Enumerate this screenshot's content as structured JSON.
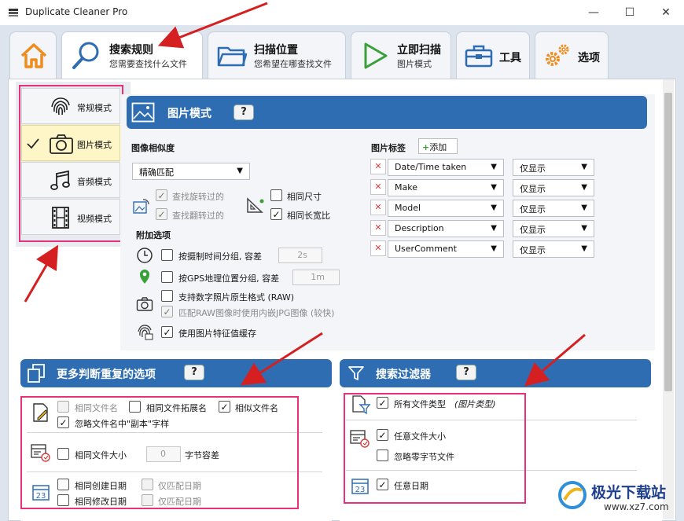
{
  "window": {
    "title": "Duplicate Cleaner Pro",
    "controls": [
      "—",
      "☐",
      "✕"
    ]
  },
  "tabs": [
    {
      "id": "home",
      "label": ""
    },
    {
      "id": "search-rules",
      "label": "搜索规则",
      "sub": "您需要查找什么文件"
    },
    {
      "id": "scan-location",
      "label": "扫描位置",
      "sub": "您希望在哪查找文件"
    },
    {
      "id": "scan-now",
      "label": "立即扫描",
      "sub": "图片模式"
    },
    {
      "id": "tools",
      "label": "工具"
    },
    {
      "id": "options",
      "label": "选项"
    }
  ],
  "modes": [
    {
      "label": "常规模式",
      "icon": "fingerprint-icon",
      "selected": false
    },
    {
      "label": "图片模式",
      "icon": "camera-icon",
      "selected": true
    },
    {
      "label": "音频模式",
      "icon": "music-note-icon",
      "selected": false
    },
    {
      "label": "视频模式",
      "icon": "film-icon",
      "selected": false
    }
  ],
  "image_mode": {
    "title": "图片模式",
    "help": "?",
    "similarity": {
      "label": "图像相似度",
      "value": "精确匹配"
    },
    "rotate": {
      "label": "查找旋转过的",
      "checked": true
    },
    "flip": {
      "label": "查找翻转过的",
      "checked": true
    },
    "same_size": {
      "label": "相同尺寸",
      "checked": false
    },
    "same_ratio": {
      "label": "相同长宽比",
      "checked": true
    },
    "extra": {
      "label": "附加选项",
      "time_group": {
        "label": "按摄制时间分组, 容差",
        "checked": false,
        "value": "2s"
      },
      "gps_group": {
        "label": "按GPS地理位置分组, 容差",
        "checked": false,
        "value": "1m"
      },
      "raw": {
        "label": "支持数字照片原生格式 (RAW)",
        "checked": false
      },
      "raw_jpg": {
        "label": "匹配RAW图像时使用内嵌JPG图像 (较快)",
        "checked": true
      },
      "cache": {
        "label": "使用图片特征值缓存",
        "checked": true
      }
    },
    "tags": {
      "label": "图片标签",
      "add_label": "添加",
      "rows": [
        {
          "tag": "Date/Time taken",
          "mode": "仅显示"
        },
        {
          "tag": "Make",
          "mode": "仅显示"
        },
        {
          "tag": "Model",
          "mode": "仅显示"
        },
        {
          "tag": "Description",
          "mode": "仅显示"
        },
        {
          "tag": "UserComment",
          "mode": "仅显示"
        }
      ]
    }
  },
  "more_options": {
    "title": "更多判断重复的选项",
    "help": "?",
    "same_name": {
      "label": "相同文件名",
      "checked": false
    },
    "same_ext": {
      "label": "相同文件拓展名",
      "checked": false
    },
    "similar_name": {
      "label": "相似文件名",
      "checked": true
    },
    "ignore_copy": {
      "label": "忽略文件名中\"副本\"字样",
      "checked": true
    },
    "same_size": {
      "label": "相同文件大小",
      "checked": false,
      "value": "0",
      "suffix": "字节容差"
    },
    "same_created": {
      "label": "相同创建日期",
      "checked": false
    },
    "date_only_1": {
      "label": "仅匹配日期",
      "checked": false
    },
    "same_modified": {
      "label": "相同修改日期",
      "checked": false
    },
    "date_only_2": {
      "label": "仅匹配日期",
      "checked": false
    }
  },
  "search_filter": {
    "title": "搜索过滤器",
    "help": "?",
    "all_types": {
      "label": "所有文件类型",
      "hint": "(图片类型)",
      "checked": true
    },
    "any_size": {
      "label": "任意文件大小",
      "checked": true
    },
    "ignore_zero": {
      "label": "忽略零字节文件",
      "checked": false
    },
    "any_date": {
      "label": "任意日期",
      "checked": true
    }
  },
  "watermark": {
    "text": "极光下载站",
    "url": "www.xz7.com"
  },
  "colors": {
    "accent": "#2f6db2",
    "highlight": "#e8317a",
    "arrow": "#d42020",
    "selected": "#fff6c8"
  }
}
